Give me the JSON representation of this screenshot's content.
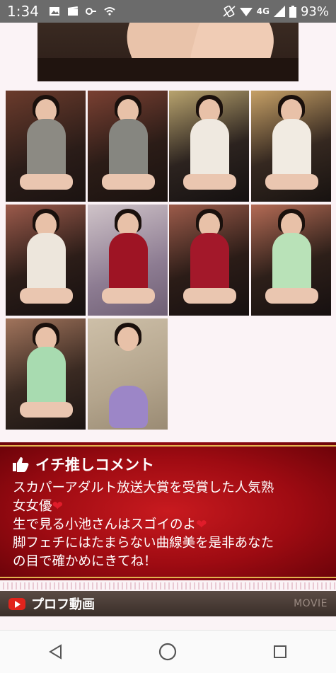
{
  "status_bar": {
    "time": "1:34",
    "network": "4G",
    "battery": "93%"
  },
  "gallery": {
    "photo_count": 10,
    "photos": [
      {
        "outfit": "gray halter dress",
        "color": "#8c8a83"
      },
      {
        "outfit": "gray halter dress",
        "color": "#868680"
      },
      {
        "outfit": "white knit dress",
        "color": "#efe9e0"
      },
      {
        "outfit": "white knit dress",
        "color": "#f1ebe2"
      },
      {
        "outfit": "white knit dress",
        "color": "#ede6dc"
      },
      {
        "outfit": "red dress",
        "color": "#9e1424"
      },
      {
        "outfit": "red dress",
        "color": "#a3182a"
      },
      {
        "outfit": "mint lace dress",
        "color": "#b9e2b8"
      },
      {
        "outfit": "mint lace dress",
        "color": "#a8dbb0"
      },
      {
        "outfit": "purple floral top",
        "color": "#9c86c7"
      }
    ]
  },
  "comment": {
    "title": "イチ推しコメント",
    "line1": "スカパーアダルト放送大賞を受賞した人気熟",
    "line2": "女女優",
    "line3": "生で見る小池さんはスゴイのよ",
    "line4": "脚フェチにはたまらない曲線美を是非あなた",
    "line5": "の目で確かめにきてね！",
    "heart": "❤"
  },
  "movie_bar": {
    "title": "プロフ動画",
    "movie_label": "MOVIE"
  },
  "colors": {
    "accent_red": "#b0101a",
    "gold_line": "#e3b44f",
    "youtube_red": "#e1241c"
  }
}
